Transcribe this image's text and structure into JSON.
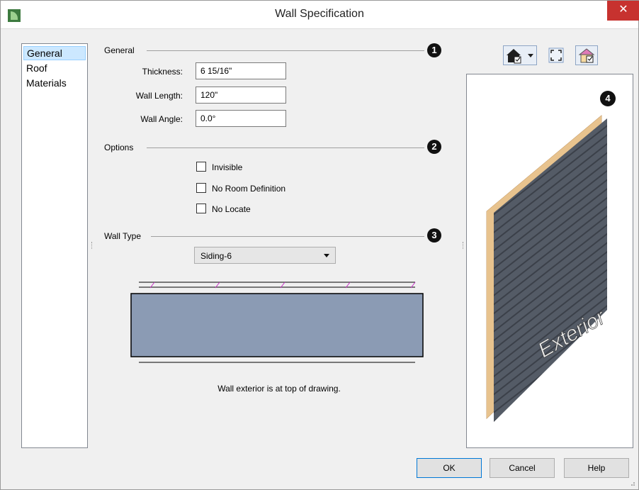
{
  "window": {
    "title": "Wall Specification",
    "close_glyph": "✕"
  },
  "sidebar": {
    "items": [
      {
        "label": "General",
        "selected": true
      },
      {
        "label": "Roof",
        "selected": false
      },
      {
        "label": "Materials",
        "selected": false
      }
    ]
  },
  "general": {
    "heading": "General",
    "badge": "1",
    "fields": [
      {
        "label": "Thickness:",
        "value": "6 15/16\""
      },
      {
        "label": "Wall Length:",
        "value": "120\""
      },
      {
        "label": "Wall Angle:",
        "value": "0.0°"
      }
    ]
  },
  "options": {
    "heading": "Options",
    "badge": "2",
    "checkboxes": [
      {
        "label": "Invisible",
        "checked": false
      },
      {
        "label": "No Room Definition",
        "checked": false
      },
      {
        "label": "No Locate",
        "checked": false
      }
    ]
  },
  "wall_type": {
    "heading": "Wall Type",
    "badge": "3",
    "selected": "Siding-6",
    "caption": "Wall exterior is at top of drawing.",
    "fill_color": "#8b9bb4",
    "siding_color": "#c62ec6"
  },
  "preview": {
    "badge": "4",
    "exterior_label": "Exterior",
    "toolbar": [
      "house-view-icon",
      "fit-to-window-icon",
      "room-view-icon"
    ]
  },
  "footer": {
    "ok_label": "OK",
    "cancel_label": "Cancel",
    "help_label": "Help"
  }
}
